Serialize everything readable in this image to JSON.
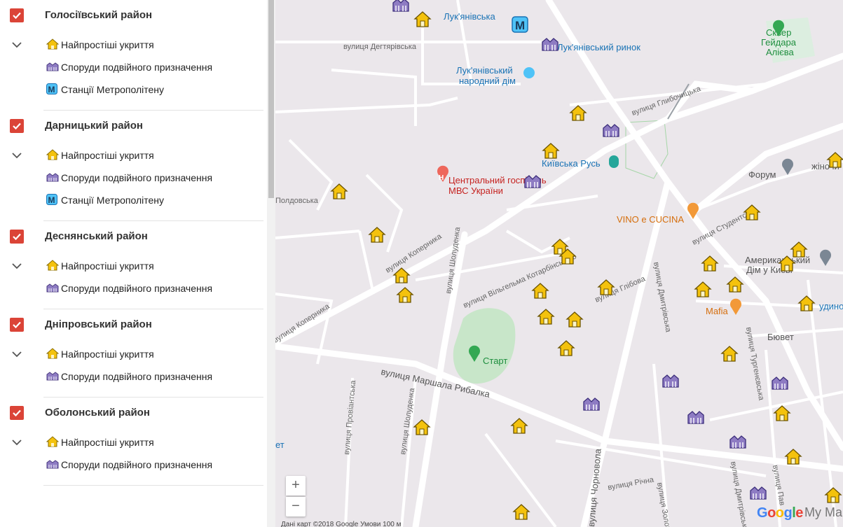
{
  "colors": {
    "checkbox": "#db4437",
    "shelter": "#f4c20d",
    "dual": "#8e7cc3",
    "metro": "#4fc3f7",
    "park": "#c8e6c9",
    "map_bg": "#ebe7eb",
    "road": "#ffffff"
  },
  "layers": [
    {
      "title": "Голосіївський район",
      "checked": true,
      "items": [
        {
          "icon": "shelter-icon",
          "label": "Найпростіші укриття"
        },
        {
          "icon": "dual-purpose-icon",
          "label": "Споруди подвійного призначення"
        },
        {
          "icon": "metro-icon",
          "label": "Станції Метрополітену"
        }
      ]
    },
    {
      "title": "Дарницький район",
      "checked": true,
      "items": [
        {
          "icon": "shelter-icon",
          "label": "Найпростіші укриття"
        },
        {
          "icon": "dual-purpose-icon",
          "label": "Споруди подвійного призначення"
        },
        {
          "icon": "metro-icon",
          "label": "Станції Метрополітену"
        }
      ]
    },
    {
      "title": "Деснянський район",
      "checked": true,
      "items": [
        {
          "icon": "shelter-icon",
          "label": "Найпростіші укриття"
        },
        {
          "icon": "dual-purpose-icon",
          "label": "Споруди подвійного призначення"
        }
      ]
    },
    {
      "title": "Дніпровський район",
      "checked": true,
      "items": [
        {
          "icon": "shelter-icon",
          "label": "Найпростіші укриття"
        },
        {
          "icon": "dual-purpose-icon",
          "label": "Споруди подвійного призначення"
        }
      ]
    },
    {
      "title": "Оболонський район",
      "checked": true,
      "items": [
        {
          "icon": "shelter-icon",
          "label": "Найпростіші укриття"
        },
        {
          "icon": "dual-purpose-icon",
          "label": "Споруди подвійного призначення"
        }
      ]
    }
  ],
  "map": {
    "streets": {
      "degtiarivska": "вулиця Дегтярівська",
      "glybochytska": "вулиця Глибочицька",
      "kopernyka_1": "вулиця Коперника",
      "kopernyka_2": "вулиця Коперника",
      "shoduldenka_1": "вулиця Шолуденка",
      "shoduldenka_2": "вулиця Шолуденка",
      "kotarbinskoho": "вулиця Вільгельма Котарбінського",
      "glibova": "вулиця Глібова",
      "dmytrivska_1": "вулиця Дмитрівська",
      "dmytrivska_2": "вулиця Дмитрівська",
      "marshala_rybalka": "вулиця Маршала Рибалка",
      "provianska": "вулиця Провіантська",
      "chornovola": "вулиця Чорновола",
      "richna": "вулиця Річна",
      "studentska": "вулиця Студентська",
      "turhenievska": "вулиця Тургенєвська",
      "zolotoustivska": "вулиця Золото",
      "poldovska": "Полдовська",
      "pavlivska": "вулиця Пав"
    },
    "pois": {
      "lukianivska": "Лук'янівська",
      "lukianivskyi_rynok": "Лук'янівський ринок",
      "narodnyi_dim_1": "Лук'янівський",
      "narodnyi_dim_2": "народний дім",
      "hospital_1": "Центральний госпіталь",
      "hospital_2": "МВС України",
      "kyivska_rus": "Київська Русь",
      "vino": "VINO e CUCINA",
      "forum": "Форум",
      "zhinochi": "жіночи",
      "sq_1": "Сквер",
      "sq_2": "Гейдара",
      "sq_3": "Алієва",
      "american_1": "Американський",
      "american_2": "Дім у Києві",
      "mafia": "Mafia",
      "start": "Старт",
      "biuvet": "Бювет",
      "budyno": "удино",
      "bet": "ет"
    },
    "zoom_in": "+",
    "zoom_out": "−",
    "google": "Google",
    "mymaps": "My Maps",
    "attribution": "Дані карт ©2018 Google    Умови    100 м"
  }
}
